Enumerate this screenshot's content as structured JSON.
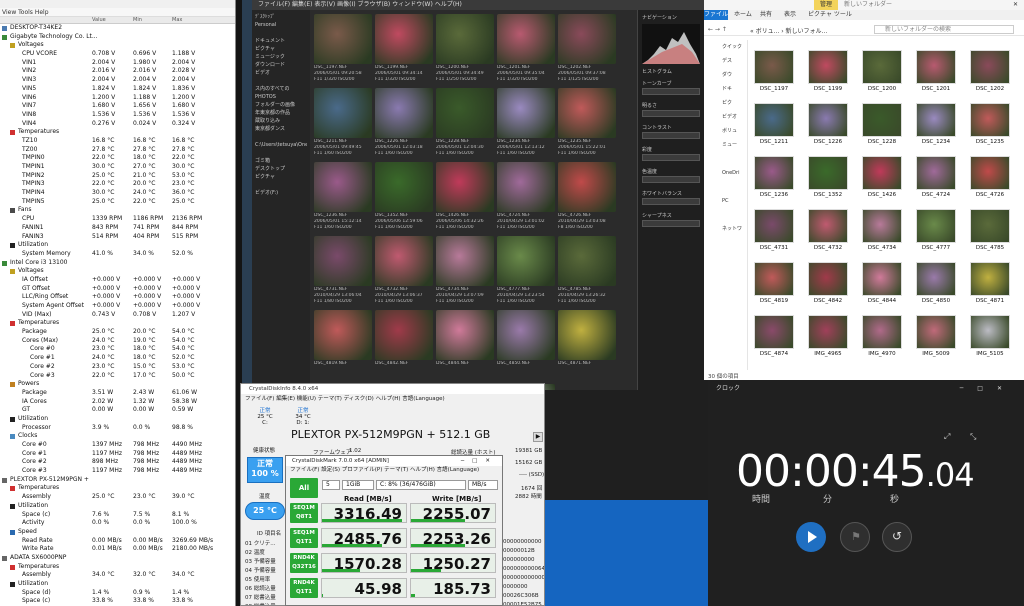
{
  "hwinfo": {
    "title": "",
    "menu": "View  Tools  Help",
    "cols": [
      "Value",
      "Min",
      "Max"
    ],
    "rows": [
      {
        "d": 0,
        "t": "DESKTOP-T34KE2",
        "v": "",
        "a": "",
        "b": "",
        "k": "root"
      },
      {
        "d": 0,
        "t": "Gigabyte Technology Co. Lt...",
        "v": "",
        "a": "",
        "b": "",
        "k": "mb"
      },
      {
        "d": 1,
        "t": "Voltages",
        "v": "",
        "a": "",
        "b": "",
        "k": "volt"
      },
      {
        "d": 2,
        "t": "CPU VCORE",
        "v": "0.708 V",
        "a": "0.696 V",
        "b": "1.188 V"
      },
      {
        "d": 2,
        "t": "VIN1",
        "v": "2.004 V",
        "a": "1.980 V",
        "b": "2.004 V"
      },
      {
        "d": 2,
        "t": "VIN2",
        "v": "2.016 V",
        "a": "2.016 V",
        "b": "2.028 V"
      },
      {
        "d": 2,
        "t": "VIN3",
        "v": "2.004 V",
        "a": "2.004 V",
        "b": "2.004 V"
      },
      {
        "d": 2,
        "t": "VIN5",
        "v": "1.824 V",
        "a": "1.824 V",
        "b": "1.836 V"
      },
      {
        "d": 2,
        "t": "VIN6",
        "v": "1.200 V",
        "a": "1.188 V",
        "b": "1.200 V"
      },
      {
        "d": 2,
        "t": "VIN7",
        "v": "1.680 V",
        "a": "1.656 V",
        "b": "1.680 V"
      },
      {
        "d": 2,
        "t": "VIN8",
        "v": "1.536 V",
        "a": "1.536 V",
        "b": "1.536 V"
      },
      {
        "d": 2,
        "t": "VIN4",
        "v": "0.276 V",
        "a": "0.024 V",
        "b": "0.324 V"
      },
      {
        "d": 1,
        "t": "Temperatures",
        "v": "",
        "a": "",
        "b": "",
        "k": "temp"
      },
      {
        "d": 2,
        "t": "TZ10",
        "v": "16.8 °C",
        "a": "16.8 °C",
        "b": "16.8 °C"
      },
      {
        "d": 2,
        "t": "TZ00",
        "v": "27.8 °C",
        "a": "27.8 °C",
        "b": "27.8 °C"
      },
      {
        "d": 2,
        "t": "TMPIN0",
        "v": "22.0 °C",
        "a": "18.0 °C",
        "b": "22.0 °C"
      },
      {
        "d": 2,
        "t": "TMPIN1",
        "v": "30.0 °C",
        "a": "27.0 °C",
        "b": "30.0 °C"
      },
      {
        "d": 2,
        "t": "TMPIN2",
        "v": "25.0 °C",
        "a": "21.0 °C",
        "b": "53.0 °C"
      },
      {
        "d": 2,
        "t": "TMPIN3",
        "v": "22.0 °C",
        "a": "20.0 °C",
        "b": "23.0 °C"
      },
      {
        "d": 2,
        "t": "TMPIN4",
        "v": "30.0 °C",
        "a": "24.0 °C",
        "b": "36.0 °C"
      },
      {
        "d": 2,
        "t": "TMPIN5",
        "v": "25.0 °C",
        "a": "22.0 °C",
        "b": "25.0 °C"
      },
      {
        "d": 1,
        "t": "Fans",
        "v": "",
        "a": "",
        "b": "",
        "k": "fan"
      },
      {
        "d": 2,
        "t": "CPU",
        "v": "1339 RPM",
        "a": "1186 RPM",
        "b": "2136 RPM"
      },
      {
        "d": 2,
        "t": "FANIN1",
        "v": "843 RPM",
        "a": "741 RPM",
        "b": "844 RPM"
      },
      {
        "d": 2,
        "t": "FANIN3",
        "v": "514 RPM",
        "a": "404 RPM",
        "b": "515 RPM"
      },
      {
        "d": 1,
        "t": "Utilization",
        "v": "",
        "a": "",
        "b": "",
        "k": "util"
      },
      {
        "d": 2,
        "t": "System Memory",
        "v": "41.0 %",
        "a": "34.0 %",
        "b": "52.0 %"
      },
      {
        "d": 0,
        "t": "Intel Core i3 13100",
        "v": "",
        "a": "",
        "b": "",
        "k": "cpu"
      },
      {
        "d": 1,
        "t": "Voltages",
        "v": "",
        "a": "",
        "b": "",
        "k": "volt"
      },
      {
        "d": 2,
        "t": "IA Offset",
        "v": "+0.000 V",
        "a": "+0.000 V",
        "b": "+0.000 V"
      },
      {
        "d": 2,
        "t": "GT Offset",
        "v": "+0.000 V",
        "a": "+0.000 V",
        "b": "+0.000 V"
      },
      {
        "d": 2,
        "t": "LLC/Ring Offset",
        "v": "+0.000 V",
        "a": "+0.000 V",
        "b": "+0.000 V"
      },
      {
        "d": 2,
        "t": "System Agent Offset",
        "v": "+0.000 V",
        "a": "+0.000 V",
        "b": "+0.000 V"
      },
      {
        "d": 2,
        "t": "VID (Max)",
        "v": "0.743 V",
        "a": "0.708 V",
        "b": "1.207 V"
      },
      {
        "d": 1,
        "t": "Temperatures",
        "v": "",
        "a": "",
        "b": "",
        "k": "temp"
      },
      {
        "d": 2,
        "t": "Package",
        "v": "25.0 °C",
        "a": "20.0 °C",
        "b": "54.0 °C"
      },
      {
        "d": 2,
        "t": "Cores (Max)",
        "v": "24.0 °C",
        "a": "19.0 °C",
        "b": "54.0 °C"
      },
      {
        "d": 3,
        "t": "Core #0",
        "v": "23.0 °C",
        "a": "18.0 °C",
        "b": "54.0 °C"
      },
      {
        "d": 3,
        "t": "Core #1",
        "v": "24.0 °C",
        "a": "18.0 °C",
        "b": "52.0 °C"
      },
      {
        "d": 3,
        "t": "Core #2",
        "v": "23.0 °C",
        "a": "15.0 °C",
        "b": "53.0 °C"
      },
      {
        "d": 3,
        "t": "Core #3",
        "v": "22.0 °C",
        "a": "17.0 °C",
        "b": "50.0 °C"
      },
      {
        "d": 1,
        "t": "Powers",
        "v": "",
        "a": "",
        "b": "",
        "k": "pow"
      },
      {
        "d": 2,
        "t": "Package",
        "v": "3.51 W",
        "a": "2.43 W",
        "b": "61.06 W"
      },
      {
        "d": 2,
        "t": "IA Cores",
        "v": "2.02 W",
        "a": "1.32 W",
        "b": "58.38 W"
      },
      {
        "d": 2,
        "t": "GT",
        "v": "0.00 W",
        "a": "0.00 W",
        "b": "0.59 W"
      },
      {
        "d": 1,
        "t": "Utilization",
        "v": "",
        "a": "",
        "b": "",
        "k": "util"
      },
      {
        "d": 2,
        "t": "Processor",
        "v": "3.9 %",
        "a": "0.0 %",
        "b": "98.8 %"
      },
      {
        "d": 1,
        "t": "Clocks",
        "v": "",
        "a": "",
        "b": "",
        "k": "clk"
      },
      {
        "d": 2,
        "t": "Core #0",
        "v": "1397 MHz",
        "a": "798 MHz",
        "b": "4490 MHz"
      },
      {
        "d": 2,
        "t": "Core #1",
        "v": "1197 MHz",
        "a": "798 MHz",
        "b": "4489 MHz"
      },
      {
        "d": 2,
        "t": "Core #2",
        "v": "898 MHz",
        "a": "798 MHz",
        "b": "4489 MHz"
      },
      {
        "d": 2,
        "t": "Core #3",
        "v": "1197 MHz",
        "a": "798 MHz",
        "b": "4489 MHz"
      },
      {
        "d": 0,
        "t": "PLEXTOR PX-512M9PGN +",
        "v": "",
        "a": "",
        "b": "",
        "k": "disk"
      },
      {
        "d": 1,
        "t": "Temperatures",
        "v": "",
        "a": "",
        "b": "",
        "k": "temp"
      },
      {
        "d": 2,
        "t": "Assembly",
        "v": "25.0 °C",
        "a": "23.0 °C",
        "b": "39.0 °C"
      },
      {
        "d": 1,
        "t": "Utilization",
        "v": "",
        "a": "",
        "b": "",
        "k": "util"
      },
      {
        "d": 2,
        "t": "Space (c)",
        "v": "7.6 %",
        "a": "7.5 %",
        "b": "8.1 %"
      },
      {
        "d": 2,
        "t": "Activity",
        "v": "0.0 %",
        "a": "0.0 %",
        "b": "100.0 %"
      },
      {
        "d": 1,
        "t": "Speed",
        "v": "",
        "a": "",
        "b": "",
        "k": "speed"
      },
      {
        "d": 2,
        "t": "Read Rate",
        "v": "0.00 MB/s",
        "a": "0.00 MB/s",
        "b": "3269.69 MB/s"
      },
      {
        "d": 2,
        "t": "Write Rate",
        "v": "0.01 MB/s",
        "a": "0.00 MB/s",
        "b": "2180.00 MB/s"
      },
      {
        "d": 0,
        "t": "ADATA SX6000PNP",
        "v": "",
        "a": "",
        "b": "",
        "k": "disk"
      },
      {
        "d": 1,
        "t": "Temperatures",
        "v": "",
        "a": "",
        "b": "",
        "k": "temp"
      },
      {
        "d": 2,
        "t": "Assembly",
        "v": "34.0 °C",
        "a": "32.0 °C",
        "b": "34.0 °C"
      },
      {
        "d": 1,
        "t": "Utilization",
        "v": "",
        "a": "",
        "b": "",
        "k": "util"
      },
      {
        "d": 2,
        "t": "Space (d)",
        "v": "1.4 %",
        "a": "0.9 %",
        "b": "1.4 %"
      },
      {
        "d": 2,
        "t": "Space (c)",
        "v": "33.8 %",
        "a": "33.8 %",
        "b": "33.8 %"
      },
      {
        "d": 2,
        "t": "Activity",
        "v": "0.0 %",
        "a": "0.0 %",
        "b": "9.9 %"
      }
    ]
  },
  "viewer": {
    "menu": "ファイル(F)  編集(E)  表示(V)  画像(I)  ブラウザ(B)  ウィンドウ(W)  ヘルプ(H)",
    "tree": [
      "ﾃﾞｽｸﾄｯﾌﾟ",
      "Personal",
      "",
      "ドキュメント",
      "ピクチャ",
      "ミュージック",
      "ダウンロード",
      "ビデオ",
      "",
      "ス内のすべての",
      "PHOTOS",
      "フォルダーの画像",
      "年東京都の作品",
      "蔵取り込み",
      "東京都ダンス",
      "",
      "C:\\Users\\tetsuya\\OneDrive",
      "",
      "ゴミ箱",
      "デスクトップ",
      "ピクチャ",
      "",
      "ビデオ(F:)"
    ],
    "thumbs": [
      {
        "n": "DSC_1197.NEF",
        "d": "2006/05/01 09:20:58",
        "s": "F11 1/320 ISO200",
        "c": "#7a5a4a"
      },
      {
        "n": "DSC_1199.NEF",
        "d": "2006/05/01 09:34:14",
        "s": "F11 1/320 ISO200",
        "c": "#c04a60"
      },
      {
        "n": "DSC_1200.NEF",
        "d": "2006/05/01 09:34:49",
        "s": "F11 1/250 ISO200",
        "c": "#5a6a3a"
      },
      {
        "n": "DSC_1201.NEF",
        "d": "2006/05/01 09:35:04",
        "s": "F11 1/320 ISO200",
        "c": "#b85a70"
      },
      {
        "n": "DSC_1202.NEF",
        "d": "2006/05/01 09:37:08",
        "s": "F11 1/125 ISO200",
        "c": "#8a4a5a"
      },
      {
        "n": "DSC_1211.NEF",
        "d": "2006/05/01 09:49:45",
        "s": "F11 1/60 ISO200",
        "c": "#4a6a8a"
      },
      {
        "n": "DSC_1226.NEF",
        "d": "2006/05/01 12:03:18",
        "s": "F11 1/60 ISO200",
        "c": "#8a7ab0"
      },
      {
        "n": "DSC_1228.NEF",
        "d": "2006/05/01 12:04:30",
        "s": "F11 1/60 ISO200",
        "c": "#3a5a2a"
      },
      {
        "n": "DSC_1234.NEF",
        "d": "2006/05/01 12:13:12",
        "s": "F11 1/60 ISO200",
        "c": "#9a8ac0"
      },
      {
        "n": "DSC_1235.NEF",
        "d": "2006/05/01 15:22:01",
        "s": "F11 1/60 ISO200",
        "c": "#c05a5a"
      },
      {
        "n": "DSC_1236.NEF",
        "d": "2006/05/01 15:12:14",
        "s": "F11 1/60 ISO200",
        "c": "#9a5a8a"
      },
      {
        "n": "DSC_1352.NEF",
        "d": "2006/05/06 12:59:06",
        "s": "F11 1/60 ISO200",
        "c": "#3a6a2a"
      },
      {
        "n": "DSC_1426.NEF",
        "d": "2006/05/06 14:32:26",
        "s": "F11 1/60 ISO200",
        "c": "#c03a5a"
      },
      {
        "n": "DSC_4724.NEF",
        "d": "2010/04/29 13:01:02",
        "s": "F11 1/60 ISO200",
        "c": "#a06a9a"
      },
      {
        "n": "DSC_4726.NEF",
        "d": "2010/04/29 13:03:08",
        "s": "F8 1/60 ISO200",
        "c": "#c04a4a"
      },
      {
        "n": "DSC_4731.NEF",
        "d": "2010/04/29 13:06:04",
        "s": "F11 1/80 ISO200",
        "c": "#7a4a6a"
      },
      {
        "n": "DSC_4732.NEF",
        "d": "2010/04/29 13:06:37",
        "s": "F11 1/60 ISO200",
        "c": "#c05a70"
      },
      {
        "n": "DSC_4734.NEF",
        "d": "2010/04/29 13:07:09",
        "s": "F11 1/60 ISO200",
        "c": "#b87a9a"
      },
      {
        "n": "DSC_4777.NEF",
        "d": "2010/04/29 13:23:54",
        "s": "F11 1/60 ISO200",
        "c": "#6a8a4a"
      },
      {
        "n": "DSC_4785.NEF",
        "d": "2010/04/29 13:26:32",
        "s": "F11 1/60 ISO200",
        "c": "#5a6a3a"
      },
      {
        "n": "DSC_4819.NEF",
        "d": "",
        "s": "",
        "c": "#c05a5a"
      },
      {
        "n": "DSC_4842.NEF",
        "d": "",
        "s": "",
        "c": "#a03a4a"
      },
      {
        "n": "DSC_4844.NEF",
        "d": "",
        "s": "",
        "c": "#d07a9a"
      },
      {
        "n": "DSC_4850.NEF",
        "d": "",
        "s": "",
        "c": "#9a7aaa"
      },
      {
        "n": "DSC_4871.NEF",
        "d": "",
        "s": "",
        "c": "#c0b040"
      },
      {
        "n": "",
        "d": "",
        "s": "",
        "c": "#8a6a5a"
      },
      {
        "n": "",
        "d": "",
        "s": "",
        "c": "#a05a6a"
      },
      {
        "n": "",
        "d": "",
        "s": "",
        "c": "#6a4a5a"
      },
      {
        "n": "DSC_5105.CR2",
        "d": "2010/05/08 10:41:07",
        "s": "F5.6 1/250 ISO200",
        "c": "#cacad0"
      }
    ],
    "side": {
      "pre": "ナビゲーション",
      "hist": "ヒストグラム",
      "labels": [
        "トーンカーブ",
        "明るさ",
        "コントラスト",
        "彩度",
        "色温度",
        "ホワイトバランス",
        "シャープネス"
      ]
    }
  },
  "explorer": {
    "tab_manage": "管理",
    "title": "新しいフォルダー",
    "ribbon": [
      "ファイル",
      "ホーム",
      "共有",
      "表示",
      "ピクチャ ツール"
    ],
    "address": "« ボリュ... › 新しいフォル...",
    "search": "新しいフォルダーの検索",
    "nav": [
      "クイック",
      "デス",
      "ダウ",
      "ドキ",
      "ピク",
      "ビデオ",
      "ボリュ",
      "ミュー",
      "",
      "OneDri",
      "",
      "PC",
      "",
      "ネットワ"
    ],
    "files": [
      "DSC_1197",
      "DSC_1199",
      "DSC_1200",
      "DSC_1201",
      "DSC_1202",
      "DSC_1211",
      "DSC_1226",
      "DSC_1228",
      "DSC_1234",
      "DSC_1235",
      "DSC_1236",
      "DSC_1352",
      "DSC_1426",
      "DSC_4724",
      "DSC_4726",
      "DSC_4731",
      "DSC_4732",
      "DSC_4734",
      "DSC_4777",
      "DSC_4785",
      "DSC_4819",
      "DSC_4842",
      "DSC_4844",
      "DSC_4850",
      "DSC_4871",
      "DSC_4874",
      "IMG_4965",
      "IMG_4970",
      "IMG_5009",
      "IMG_5105"
    ],
    "colors": [
      "#7a5a4a",
      "#c04a60",
      "#5a6a3a",
      "#b85a70",
      "#8a4a5a",
      "#4a6a8a",
      "#8a7ab0",
      "#3a5a2a",
      "#9a8ac0",
      "#c05a5a",
      "#9a5a8a",
      "#3a6a2a",
      "#c03a5a",
      "#a06a9a",
      "#c04a4a",
      "#7a4a6a",
      "#c05a70",
      "#b87a9a",
      "#6a8a4a",
      "#5a6a3a",
      "#c05a5a",
      "#a03a4a",
      "#d07a9a",
      "#9a7aaa",
      "#c0b040",
      "#8a4a6a",
      "#a0405a",
      "#b06a8a",
      "#c06a7a",
      "#bcbcc4"
    ],
    "status": "30 個の項目"
  },
  "clock": {
    "title": "クロック",
    "hh": "00",
    "mm": "00",
    "ss": "45",
    "ms": ".04",
    "lab_h": "時間",
    "lab_m": "分",
    "lab_s": "秒"
  },
  "cdi": {
    "title": "CrystalDiskInfo 8.4.0 x64",
    "menu": "ファイル(F)  編集(E)  機能(U)  テーマ(T)  ディスク(D)  ヘルプ(H)  言語(Language)",
    "d1_status": "正常",
    "d1_temp": "25 °C",
    "d1_drive": "C:",
    "d2_status": "正常",
    "d2_temp": "34 °C",
    "d2_drive": "D: 1:",
    "model": "PLEXTOR PX-512M9PGN + 512.1 GB",
    "health_label": "健康状態",
    "health": "正常",
    "health_pct": "100 %",
    "temp_label": "温度",
    "temp": "25 °C",
    "fw_label": "ファームウェア",
    "fw": "1.02",
    "host_read_label": "総読込量 (ホスト)",
    "host_read": "19381 GB",
    "host_write": "15162 GB",
    "rpm": "---- (SSD)",
    "count": "1674 回",
    "hours": "2882 時間",
    "table_header": "ID  項目名",
    "table_rows": [
      "01 クリテ...",
      "02 温度",
      "03 予備容量",
      "04 予備容量",
      "05 使用率",
      "06 総読込量",
      "07 総書込量",
      "08 総書込量"
    ],
    "raw": [
      "00000000000",
      "00000012B",
      "000000000",
      "000000000064",
      "000000000000",
      "0000000",
      "00026C306B",
      "00001E52B75"
    ]
  },
  "cdm": {
    "title": "CrystalDiskMark 7.0.0 x64 [ADMIN]",
    "menu": "ファイル(F)  設定(S)  プロファイル(P)  テーマ(T)  ヘルプ(H)  言語(Language)",
    "all": "All",
    "count": "5",
    "size": "1GiB",
    "drive": "C: 8% (36/476GiB)",
    "unit": "MB/s",
    "read_hdr": "Read [MB/s]",
    "write_hdr": "Write [MB/s]",
    "tests": [
      {
        "a": "SEQ1M",
        "b": "Q8T1",
        "r": "3316.49",
        "w": "2255.07"
      },
      {
        "a": "SEQ1M",
        "b": "Q1T1",
        "r": "2485.76",
        "w": "2253.26"
      },
      {
        "a": "RND4K",
        "b": "Q32T16",
        "r": "1570.28",
        "w": "1250.27"
      },
      {
        "a": "RND4K",
        "b": "Q1T1",
        "r": "45.98",
        "w": "185.73"
      }
    ]
  }
}
